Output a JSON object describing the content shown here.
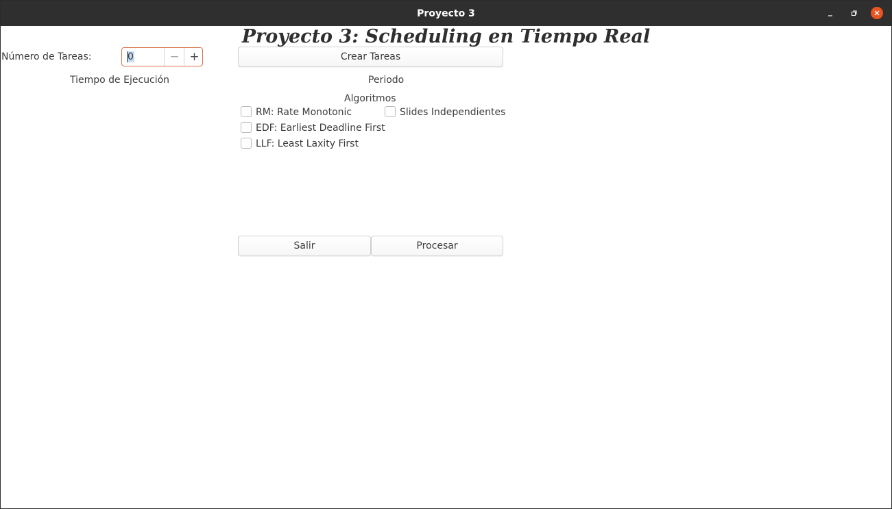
{
  "window": {
    "title": "Proyecto 3"
  },
  "main": {
    "headline": "Proyecto 3: Scheduling en Tiempo Real",
    "task_count_label": "Número de Tareas:",
    "task_count_value": "0",
    "spin_minus": "−",
    "spin_plus": "+",
    "create_tasks_button": "Crear Tareas",
    "exec_time_header": "Tiempo de Ejecución",
    "period_header": "Periodo",
    "algorithms_header": "Algoritmos",
    "algorithms": [
      {
        "label": "RM: Rate Monotonic",
        "checked": false
      },
      {
        "label": "EDF: Earliest Deadline First",
        "checked": false
      },
      {
        "label": "LLF: Least Laxity First",
        "checked": false
      }
    ],
    "slides_option": {
      "label": "Slides Independientes",
      "checked": false
    },
    "exit_button": "Salir",
    "process_button": "Procesar"
  },
  "icons": {
    "minimize": "minimize-icon",
    "maximize": "maximize-icon",
    "close": "close-icon"
  },
  "colors": {
    "titlebar": "#2f2f2f",
    "close_button": "#e95420",
    "focus_border": "#d8734a",
    "selection": "#c6dcf3"
  }
}
